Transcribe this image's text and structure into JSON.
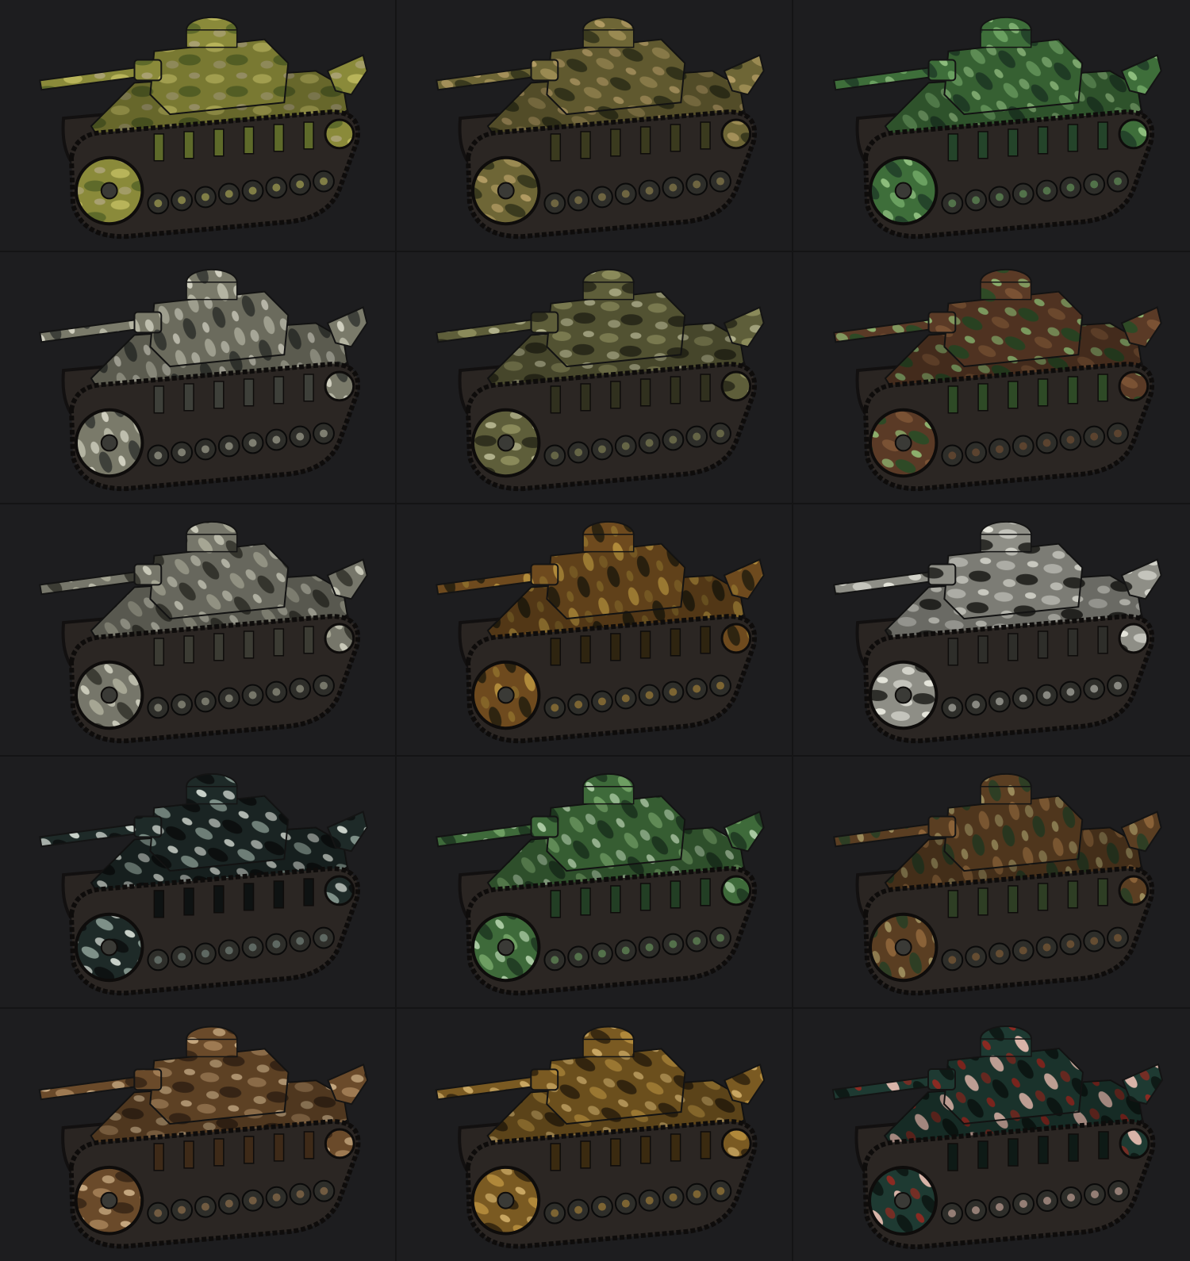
{
  "gallery": {
    "background": "#1c1c1e",
    "divider": "#141415",
    "tanks": [
      {
        "camo": "yellow-green-fine",
        "base": "#8a8a3a",
        "c1": "#b8b45a",
        "c2": "#5e6a2a",
        "c3": "#a8a070"
      },
      {
        "camo": "olive-brown-blotch",
        "base": "#6e6636",
        "c1": "#9a8a52",
        "c2": "#3a3a1e",
        "c3": "#b09a62"
      },
      {
        "camo": "green-digital",
        "base": "#3e6e3a",
        "c1": "#6aa060",
        "c2": "#24442a",
        "c3": "#8cbc7c"
      },
      {
        "camo": "grey-white-splinter",
        "base": "#7a7a6a",
        "c1": "#b4b4a2",
        "c2": "#3e403a",
        "c3": "#d0cfbf"
      },
      {
        "camo": "olive-spotted",
        "base": "#5e5e3a",
        "c1": "#8a8a5a",
        "c2": "#30301e",
        "c3": "#b0b08a"
      },
      {
        "camo": "brown-green-spotted",
        "base": "#5a3a26",
        "c1": "#7a5234",
        "c2": "#2e4a26",
        "c3": "#8cae6c"
      },
      {
        "camo": "grey-blotch",
        "base": "#76766a",
        "c1": "#a6a694",
        "c2": "#3c3c34",
        "c3": "#c8c8b8"
      },
      {
        "camo": "tiger-stripe",
        "base": "#6e4a1e",
        "c1": "#b08a3a",
        "c2": "#2e2410",
        "c3": "#8a6a2a"
      },
      {
        "camo": "white-black-blotch",
        "base": "#8e8e86",
        "c1": "#c4c4bc",
        "c2": "#2e2e2a",
        "c3": "#e4e4da"
      },
      {
        "camo": "dark-teal-black",
        "base": "#1e2a28",
        "c1": "#7e9088",
        "c2": "#0e1212",
        "c3": "#c8d0c8"
      },
      {
        "camo": "green-light-stripe",
        "base": "#3e6a3a",
        "c1": "#6e9e62",
        "c2": "#223e24",
        "c3": "#a8c8a0"
      },
      {
        "camo": "brown-green-blotch",
        "base": "#5a3e22",
        "c1": "#8a6238",
        "c2": "#2e3e24",
        "c3": "#9a8a5a"
      },
      {
        "camo": "brown-sand",
        "base": "#6a4a2a",
        "c1": "#9e7a52",
        "c2": "#3e2a18",
        "c3": "#c4a67e"
      },
      {
        "camo": "orange-brown-blotch",
        "base": "#7a5a22",
        "c1": "#b0883a",
        "c2": "#3a2a10",
        "c3": "#c8a662"
      },
      {
        "camo": "teal-pink-red",
        "base": "#1e3a32",
        "c1": "#d8b4a8",
        "c2": "#0e1a16",
        "c3": "#8a2a22"
      }
    ]
  }
}
